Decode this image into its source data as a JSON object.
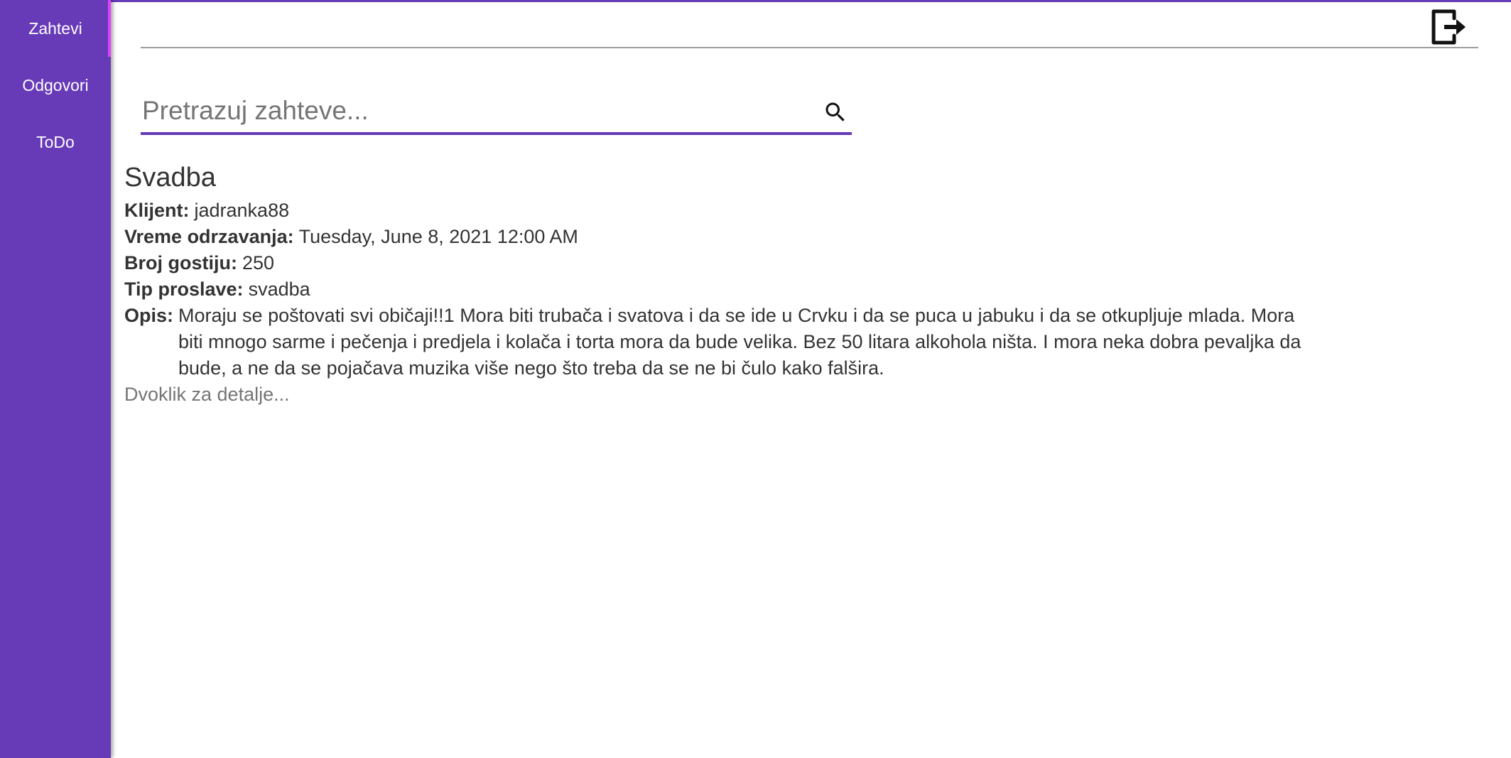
{
  "sidebar": {
    "items": [
      {
        "label": "Zahtevi",
        "active": true
      },
      {
        "label": "Odgovori",
        "active": false
      },
      {
        "label": "ToDo",
        "active": false
      }
    ]
  },
  "header": {
    "logout_icon": "logout-icon"
  },
  "search": {
    "placeholder": "Pretrazuj zahteve...",
    "value": "",
    "icon": "search-icon"
  },
  "request": {
    "title": "Svadba",
    "client_label": "Klijent:",
    "client": "jadranka88",
    "time_label": "Vreme odrzavanja:",
    "time": "Tuesday, June 8, 2021 12:00 AM",
    "guests_label": "Broj gostiju:",
    "guests": "250",
    "type_label": "Tip proslave:",
    "type": "svadba",
    "desc_label": "Opis:",
    "desc": "Moraju se poštovati svi običaji!!1 Mora biti trubača i svatova i da se ide u Crvku i da se puca u jabuku i da se otkupljuje mlada. Mora biti mnogo sarme i pečenja i predjela i kolača i torta mora da bude velika. Bez 50 litara alkohola ništa. I mora neka dobra pevaljka da bude, a ne da se pojačava muzika više nego što treba da se ne bi čulo kako falšira.",
    "hint": "Dvoklik za detalje..."
  },
  "colors": {
    "accent": "#673ab7",
    "active_indicator": "#e040fb",
    "divider": "#9e9e9e",
    "text": "#333333",
    "muted": "#757575"
  }
}
